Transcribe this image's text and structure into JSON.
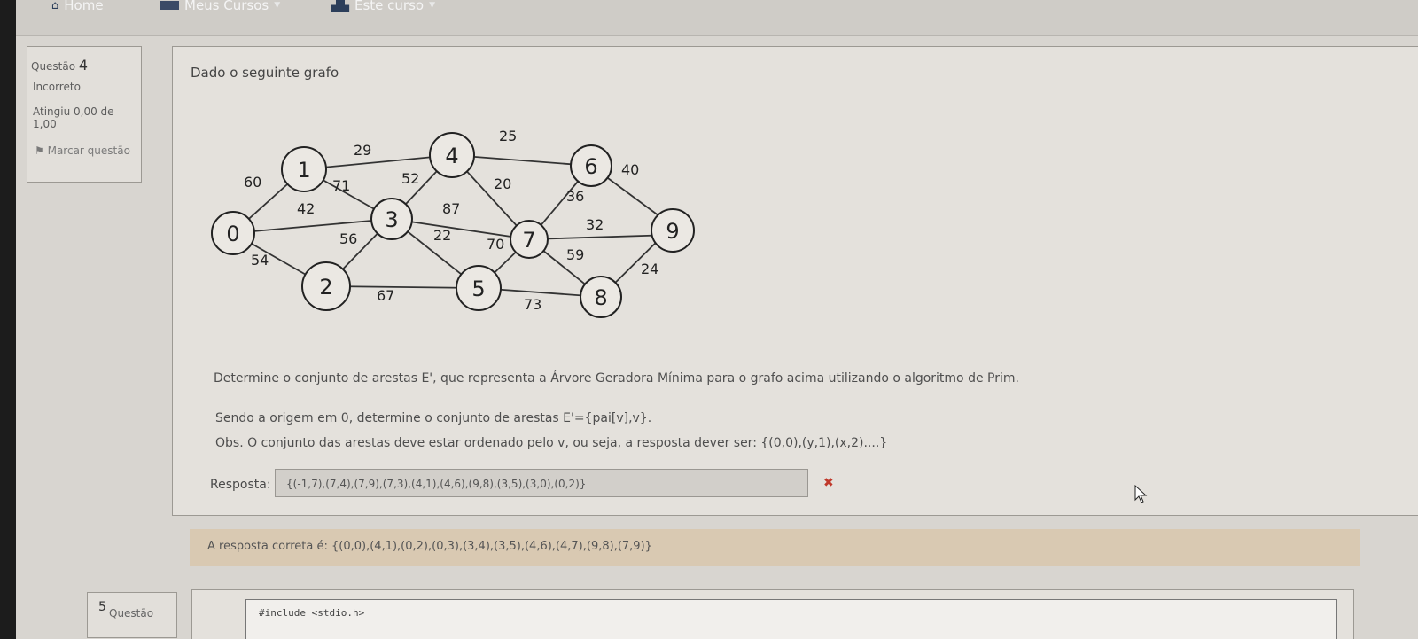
{
  "nav": {
    "home": "Home",
    "meus_cursos": "Meus Cursos",
    "este_curso": "Este curso"
  },
  "question4": {
    "label": "Questão",
    "number": "4",
    "state": "Incorreto",
    "grade": "Atingiu 0,00 de 1,00",
    "flag": "Marcar questão",
    "intro": "Dado o seguinte grafo",
    "prompt1": "Determine o conjunto de arestas E', que representa a Árvore Geradora Mínima para o grafo acima utilizando o algoritmo de Prim.",
    "prompt2": "Sendo a origem em 0, determine o conjunto de arestas E'={pai[v],v}.",
    "prompt3": "Obs. O conjunto das arestas deve estar ordenado pelo v, ou seja, a resposta dever ser: {(0,0),(y,1),(x,2)....}",
    "answer_label": "Resposta:",
    "answer_value": "{(-1,7),(7,4),(7,9),(7,3),(4,1),(4,6),(9,8),(3,5),(3,0),(0,2)}",
    "wrong_mark": "✖",
    "feedback": "A resposta correta é: {(0,0),(4,1),(0,2),(0,3),(3,4),(3,5),(4,6),(4,7),(9,8),(7,9)}"
  },
  "graph": {
    "nodes": [
      "0",
      "1",
      "2",
      "3",
      "4",
      "5",
      "6",
      "7",
      "8",
      "9"
    ],
    "edge_weights": [
      "60",
      "54",
      "42",
      "29",
      "71",
      "52",
      "56",
      "67",
      "25",
      "87",
      "20",
      "22",
      "70",
      "73",
      "36",
      "40",
      "32",
      "59",
      "24"
    ]
  },
  "question5": {
    "label": "Questão",
    "number": "5",
    "code_line": "#include <stdio.h>"
  }
}
